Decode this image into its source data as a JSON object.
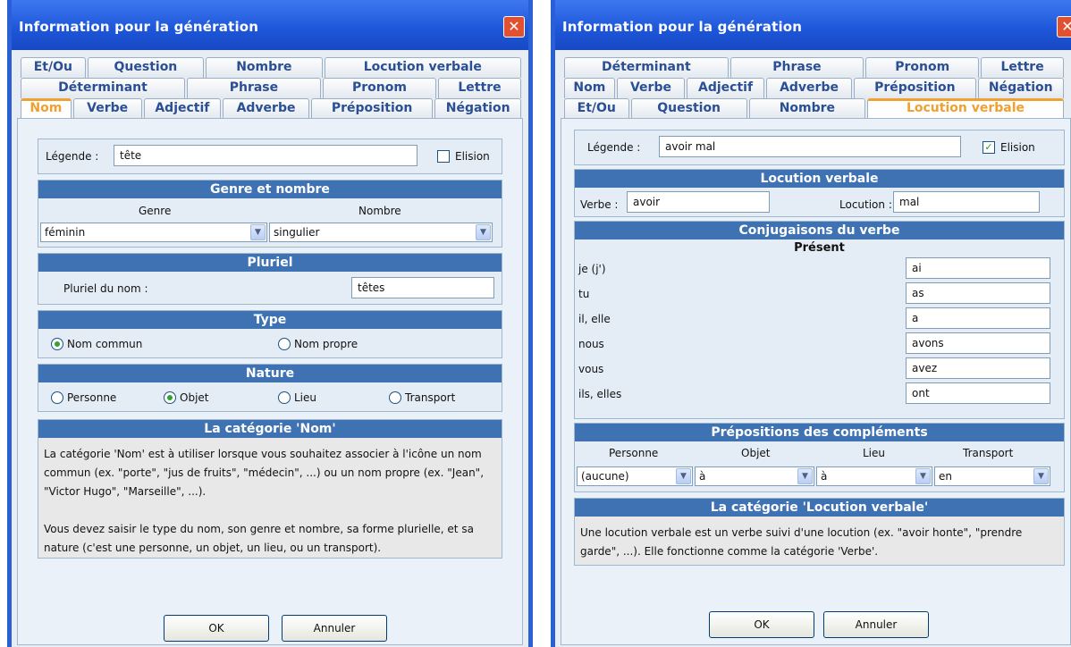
{
  "left": {
    "title": "Information pour la génération",
    "close_icon": "close-icon",
    "tabs_row1": [
      "Et/Ou",
      "Question",
      "Nombre",
      "Locution verbale"
    ],
    "tabs_row2": [
      "Déterminant",
      "Phrase",
      "Pronom",
      "Lettre"
    ],
    "tabs_row3": [
      "Nom",
      "Verbe",
      "Adjectif",
      "Adverbe",
      "Préposition",
      "Négation"
    ],
    "active_tab": "Nom",
    "legende_label": "Légende :",
    "legende_value": "tête",
    "elision_label": "Elision",
    "elision_checked": false,
    "genre_nombre_header": "Genre et nombre",
    "genre_label": "Genre",
    "nombre_label": "Nombre",
    "genre_value": "féminin",
    "nombre_value": "singulier",
    "pluriel_header": "Pluriel",
    "pluriel_label": "Pluriel du nom :",
    "pluriel_value": "têtes",
    "type_header": "Type",
    "type_options": [
      "Nom commun",
      "Nom propre"
    ],
    "type_selected": "Nom commun",
    "nature_header": "Nature",
    "nature_options": [
      "Personne",
      "Objet",
      "Lieu",
      "Transport"
    ],
    "nature_selected": "Objet",
    "category_header": "La catégorie 'Nom'",
    "description_1": "La catégorie 'Nom' est à utiliser lorsque vous souhaitez associer à l'icône un nom commun (ex. \"porte\", \"jus de fruits\", \"médecin\", ...) ou un nom propre (ex. \"Jean\", \"Victor Hugo\", \"Marseille\", ...).",
    "description_2": "Vous devez saisir le type du nom, son genre et nombre, sa forme plurielle, et sa nature (c'est une personne, un objet, un lieu, ou un transport).",
    "ok_label": "OK",
    "cancel_label": "Annuler"
  },
  "right": {
    "title": "Information pour la génération",
    "close_icon": "close-icon",
    "tabs_row1": [
      "Déterminant",
      "Phrase",
      "Pronom",
      "Lettre"
    ],
    "tabs_row2": [
      "Nom",
      "Verbe",
      "Adjectif",
      "Adverbe",
      "Préposition",
      "Négation"
    ],
    "tabs_row3": [
      "Et/Ou",
      "Question",
      "Nombre",
      "Locution verbale"
    ],
    "active_tab": "Locution verbale",
    "legende_label": "Légende :",
    "legende_value": "avoir mal",
    "elision_label": "Elision",
    "elision_checked": true,
    "locution_header": "Locution verbale",
    "verbe_label": "Verbe :",
    "verbe_value": "avoir",
    "locution_label": "Locution :",
    "locution_value": "mal",
    "conjugaisons_header": "Conjugaisons du verbe",
    "tense_label": "Présent",
    "conjugations": [
      {
        "pronoun": "je (j')",
        "form": "ai"
      },
      {
        "pronoun": "tu",
        "form": "as"
      },
      {
        "pronoun": "il, elle",
        "form": "a"
      },
      {
        "pronoun": "nous",
        "form": "avons"
      },
      {
        "pronoun": "vous",
        "form": "avez"
      },
      {
        "pronoun": "ils, elles",
        "form": "ont"
      }
    ],
    "prepositions_header": "Prépositions des compléments",
    "prep_columns": [
      {
        "label": "Personne",
        "value": "(aucune)"
      },
      {
        "label": "Objet",
        "value": "à"
      },
      {
        "label": "Lieu",
        "value": "à"
      },
      {
        "label": "Transport",
        "value": "en"
      }
    ],
    "category_header": "La catégorie 'Locution verbale'",
    "description": "Une locution verbale est un verbe suivi d'une locution (ex. \"avoir honte\", \"prendre garde\", ...). Elle fonctionne comme la catégorie 'Verbe'.",
    "ok_label": "OK",
    "cancel_label": "Annuler"
  }
}
